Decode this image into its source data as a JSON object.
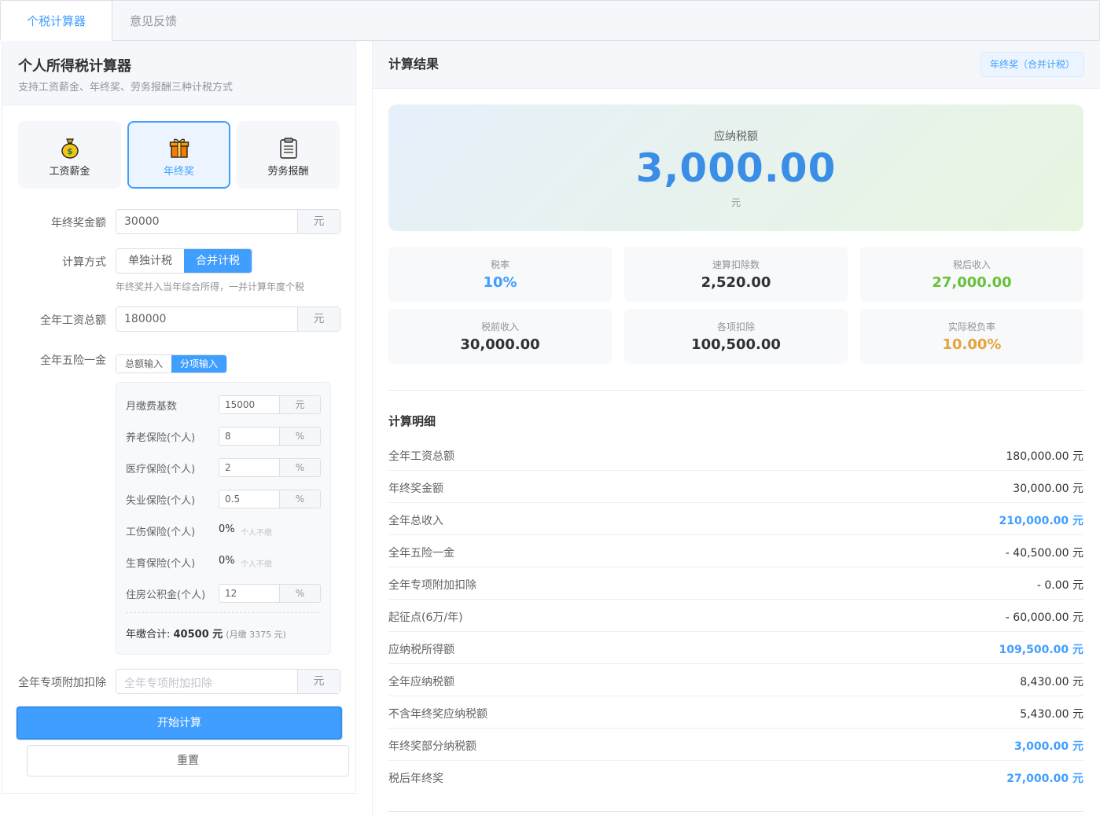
{
  "tabs": [
    {
      "label": "个税计算器"
    },
    {
      "label": "意见反馈"
    }
  ],
  "left": {
    "title": "个人所得税计算器",
    "subtitle": "支持工资薪金、年终奖、劳务报酬三种计税方式",
    "modes": [
      {
        "label": "工资薪金",
        "icon": "money-bag-icon"
      },
      {
        "label": "年终奖",
        "icon": "gift-icon"
      },
      {
        "label": "劳务报酬",
        "icon": "clipboard-icon"
      }
    ],
    "bonus_label": "年终奖金额",
    "bonus_value": "30000",
    "unit_yuan": "元",
    "method_label": "计算方式",
    "method_options": [
      "单独计税",
      "合并计税"
    ],
    "method_hint": "年终奖并入当年综合所得，一并计算年度个税",
    "salary_label": "全年工资总额",
    "salary_value": "180000",
    "insurance_label": "全年五险一金",
    "insurance_options": [
      "总额输入",
      "分项输入"
    ],
    "insurance_items": [
      {
        "label": "月缴费基数",
        "value": "15000",
        "unit": "元"
      },
      {
        "label": "养老保险(个人)",
        "value": "8",
        "unit": "%"
      },
      {
        "label": "医疗保险(个人)",
        "value": "2",
        "unit": "%"
      },
      {
        "label": "失业保险(个人)",
        "value": "0.5",
        "unit": "%"
      },
      {
        "label": "工伤保险(个人)",
        "value": "0%",
        "note": "个人不缴"
      },
      {
        "label": "生育保险(个人)",
        "value": "0%",
        "note": "个人不缴"
      },
      {
        "label": "住房公积金(个人)",
        "value": "12",
        "unit": "%"
      }
    ],
    "insurance_total_prefix": "年缴合计: ",
    "insurance_total_value": "40500 元",
    "insurance_monthly": "(月缴 3375 元)",
    "special_label": "全年专项附加扣除",
    "special_placeholder": "全年专项附加扣除",
    "calc_button": "开始计算",
    "reset_button": "重置"
  },
  "right": {
    "title": "计算结果",
    "badge": "年终奖（合并计税）",
    "tax_caption": "应纳税额",
    "tax_amount": "3,000.00",
    "tax_unit": "元",
    "stats": [
      {
        "label": "税率",
        "value": "10%"
      },
      {
        "label": "速算扣除数",
        "value": "2,520.00"
      },
      {
        "label": "税后收入",
        "value": "27,000.00"
      },
      {
        "label": "税前收入",
        "value": "30,000.00"
      },
      {
        "label": "各项扣除",
        "value": "100,500.00"
      },
      {
        "label": "实际税负率",
        "value": "10.00%"
      }
    ],
    "details_title": "计算明细",
    "details": [
      {
        "label": "全年工资总额",
        "value": "180,000.00 元"
      },
      {
        "label": "年终奖金额",
        "value": "30,000.00 元"
      },
      {
        "label": "全年总收入",
        "value": "210,000.00 元"
      },
      {
        "label": "全年五险一金",
        "value": "- 40,500.00 元"
      },
      {
        "label": "全年专项附加扣除",
        "value": "- 0.00 元"
      },
      {
        "label": "起征点(6万/年)",
        "value": "- 60,000.00 元"
      },
      {
        "label": "应纳税所得额",
        "value": "109,500.00 元"
      },
      {
        "label": "全年应纳税额",
        "value": "8,430.00 元"
      },
      {
        "label": "不含年终奖应纳税额",
        "value": "5,430.00 元"
      },
      {
        "label": "年终奖部分纳税额",
        "value": "3,000.00 元"
      },
      {
        "label": "税后年终奖",
        "value": "27,000.00 元"
      }
    ]
  },
  "colors": {
    "primary": "#409eff",
    "success": "#67c23a",
    "warning": "#e6a23c"
  }
}
